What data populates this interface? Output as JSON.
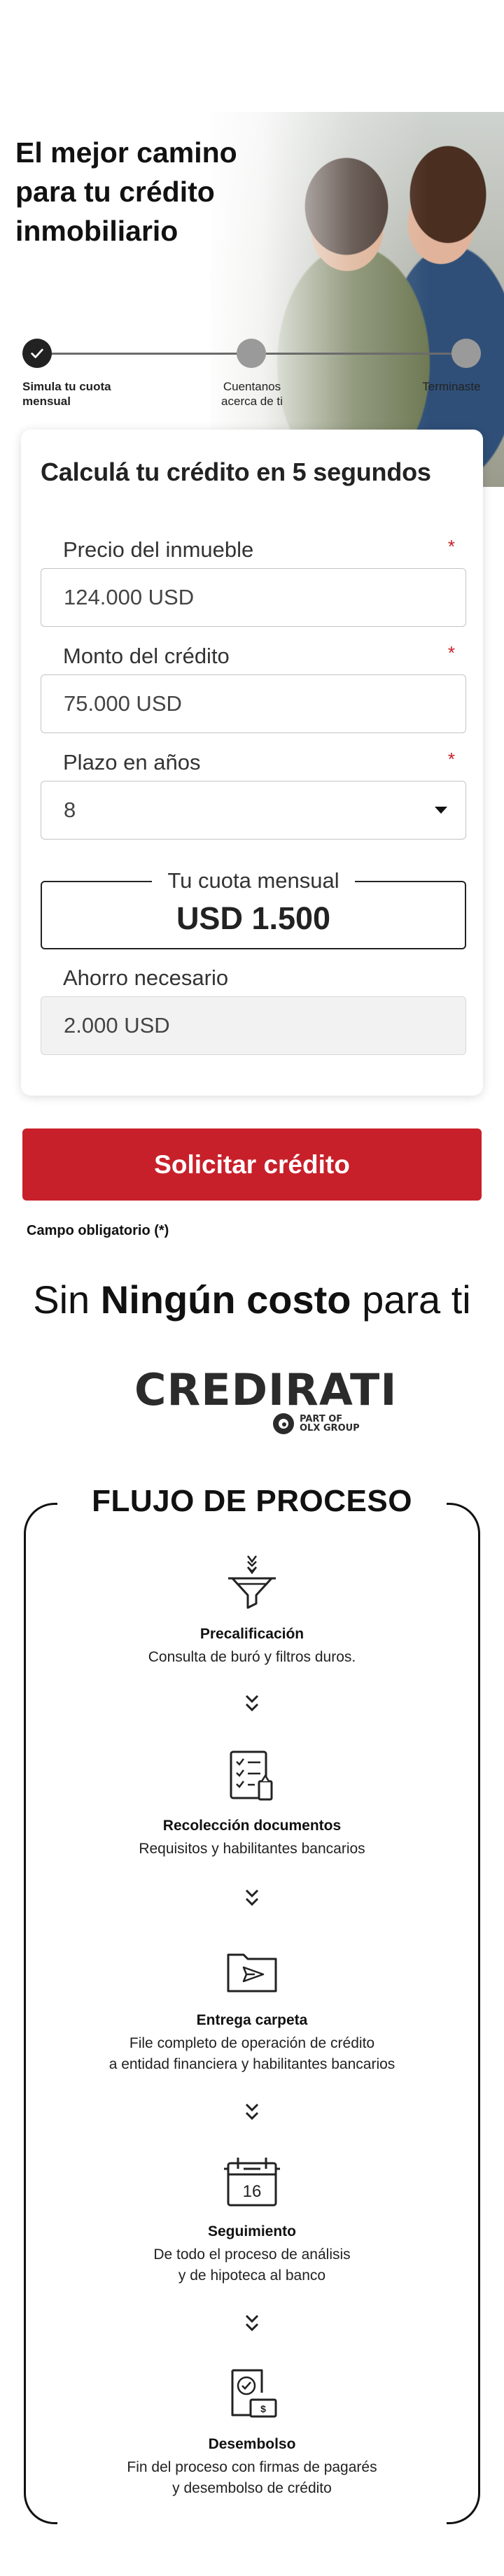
{
  "hero": {
    "title_bold": "El mejor camino",
    "title_line2": "para tu crédito",
    "title_line3": "inmobiliario"
  },
  "stepper": {
    "steps": [
      {
        "label_line1": "Simula tu cuota",
        "label_line2": "mensual",
        "state": "done"
      },
      {
        "label_line1": "Cuentanos",
        "label_line2": "acerca de ti",
        "state": "pending"
      },
      {
        "label_line1": "Terminaste",
        "label_line2": "",
        "state": "pending"
      }
    ]
  },
  "form": {
    "title": "Calculá tu crédito en 5 segundos",
    "required_mark": "*",
    "price": {
      "label": "Precio del inmueble",
      "value": "124.000 USD"
    },
    "amount": {
      "label": "Monto del crédito",
      "value": "75.000 USD"
    },
    "term": {
      "label": "Plazo en años",
      "value": "8"
    },
    "monthly": {
      "label": "Tu cuota mensual",
      "value": "USD 1.500"
    },
    "savings": {
      "label": "Ahorro necesario",
      "value": "2.000 USD"
    }
  },
  "cta": {
    "label": "Solicitar crédito"
  },
  "required_note": "Campo obligatorio (*)",
  "cost": {
    "pre": "Sin",
    "bold": "Ningún costo",
    "post": "para ti"
  },
  "logo": {
    "word": "CREDIRATI",
    "sub_line1": "PART OF",
    "sub_line2": "OLX GROUP"
  },
  "flow": {
    "title": "FLUJO DE PROCESO",
    "stages": [
      {
        "icon": "funnel-icon",
        "name": "Precalificación",
        "desc1": "Consulta de buró y filtros duros.",
        "desc2": ""
      },
      {
        "icon": "checklist-document-icon",
        "name": "Recolección documentos",
        "desc1": "Requisitos y habilitantes bancarios",
        "desc2": ""
      },
      {
        "icon": "folder-send-icon",
        "name": "Entrega carpeta",
        "desc1": "File completo de operación de crédito",
        "desc2": "a entidad financiera y habilitantes bancarios"
      },
      {
        "icon": "calendar-icon",
        "name": "Seguimiento",
        "desc1": "De todo el proceso de análisis",
        "desc2": "y de hipoteca al banco",
        "calendar_day": "16"
      },
      {
        "icon": "approval-money-icon",
        "name": "Desembolso",
        "desc1": "Fin del proceso con firmas de pagarés",
        "desc2": "y desembolso de crédito"
      }
    ]
  },
  "colors": {
    "accent": "#c8202a",
    "text": "#111111",
    "border": "#c4c4c4"
  }
}
